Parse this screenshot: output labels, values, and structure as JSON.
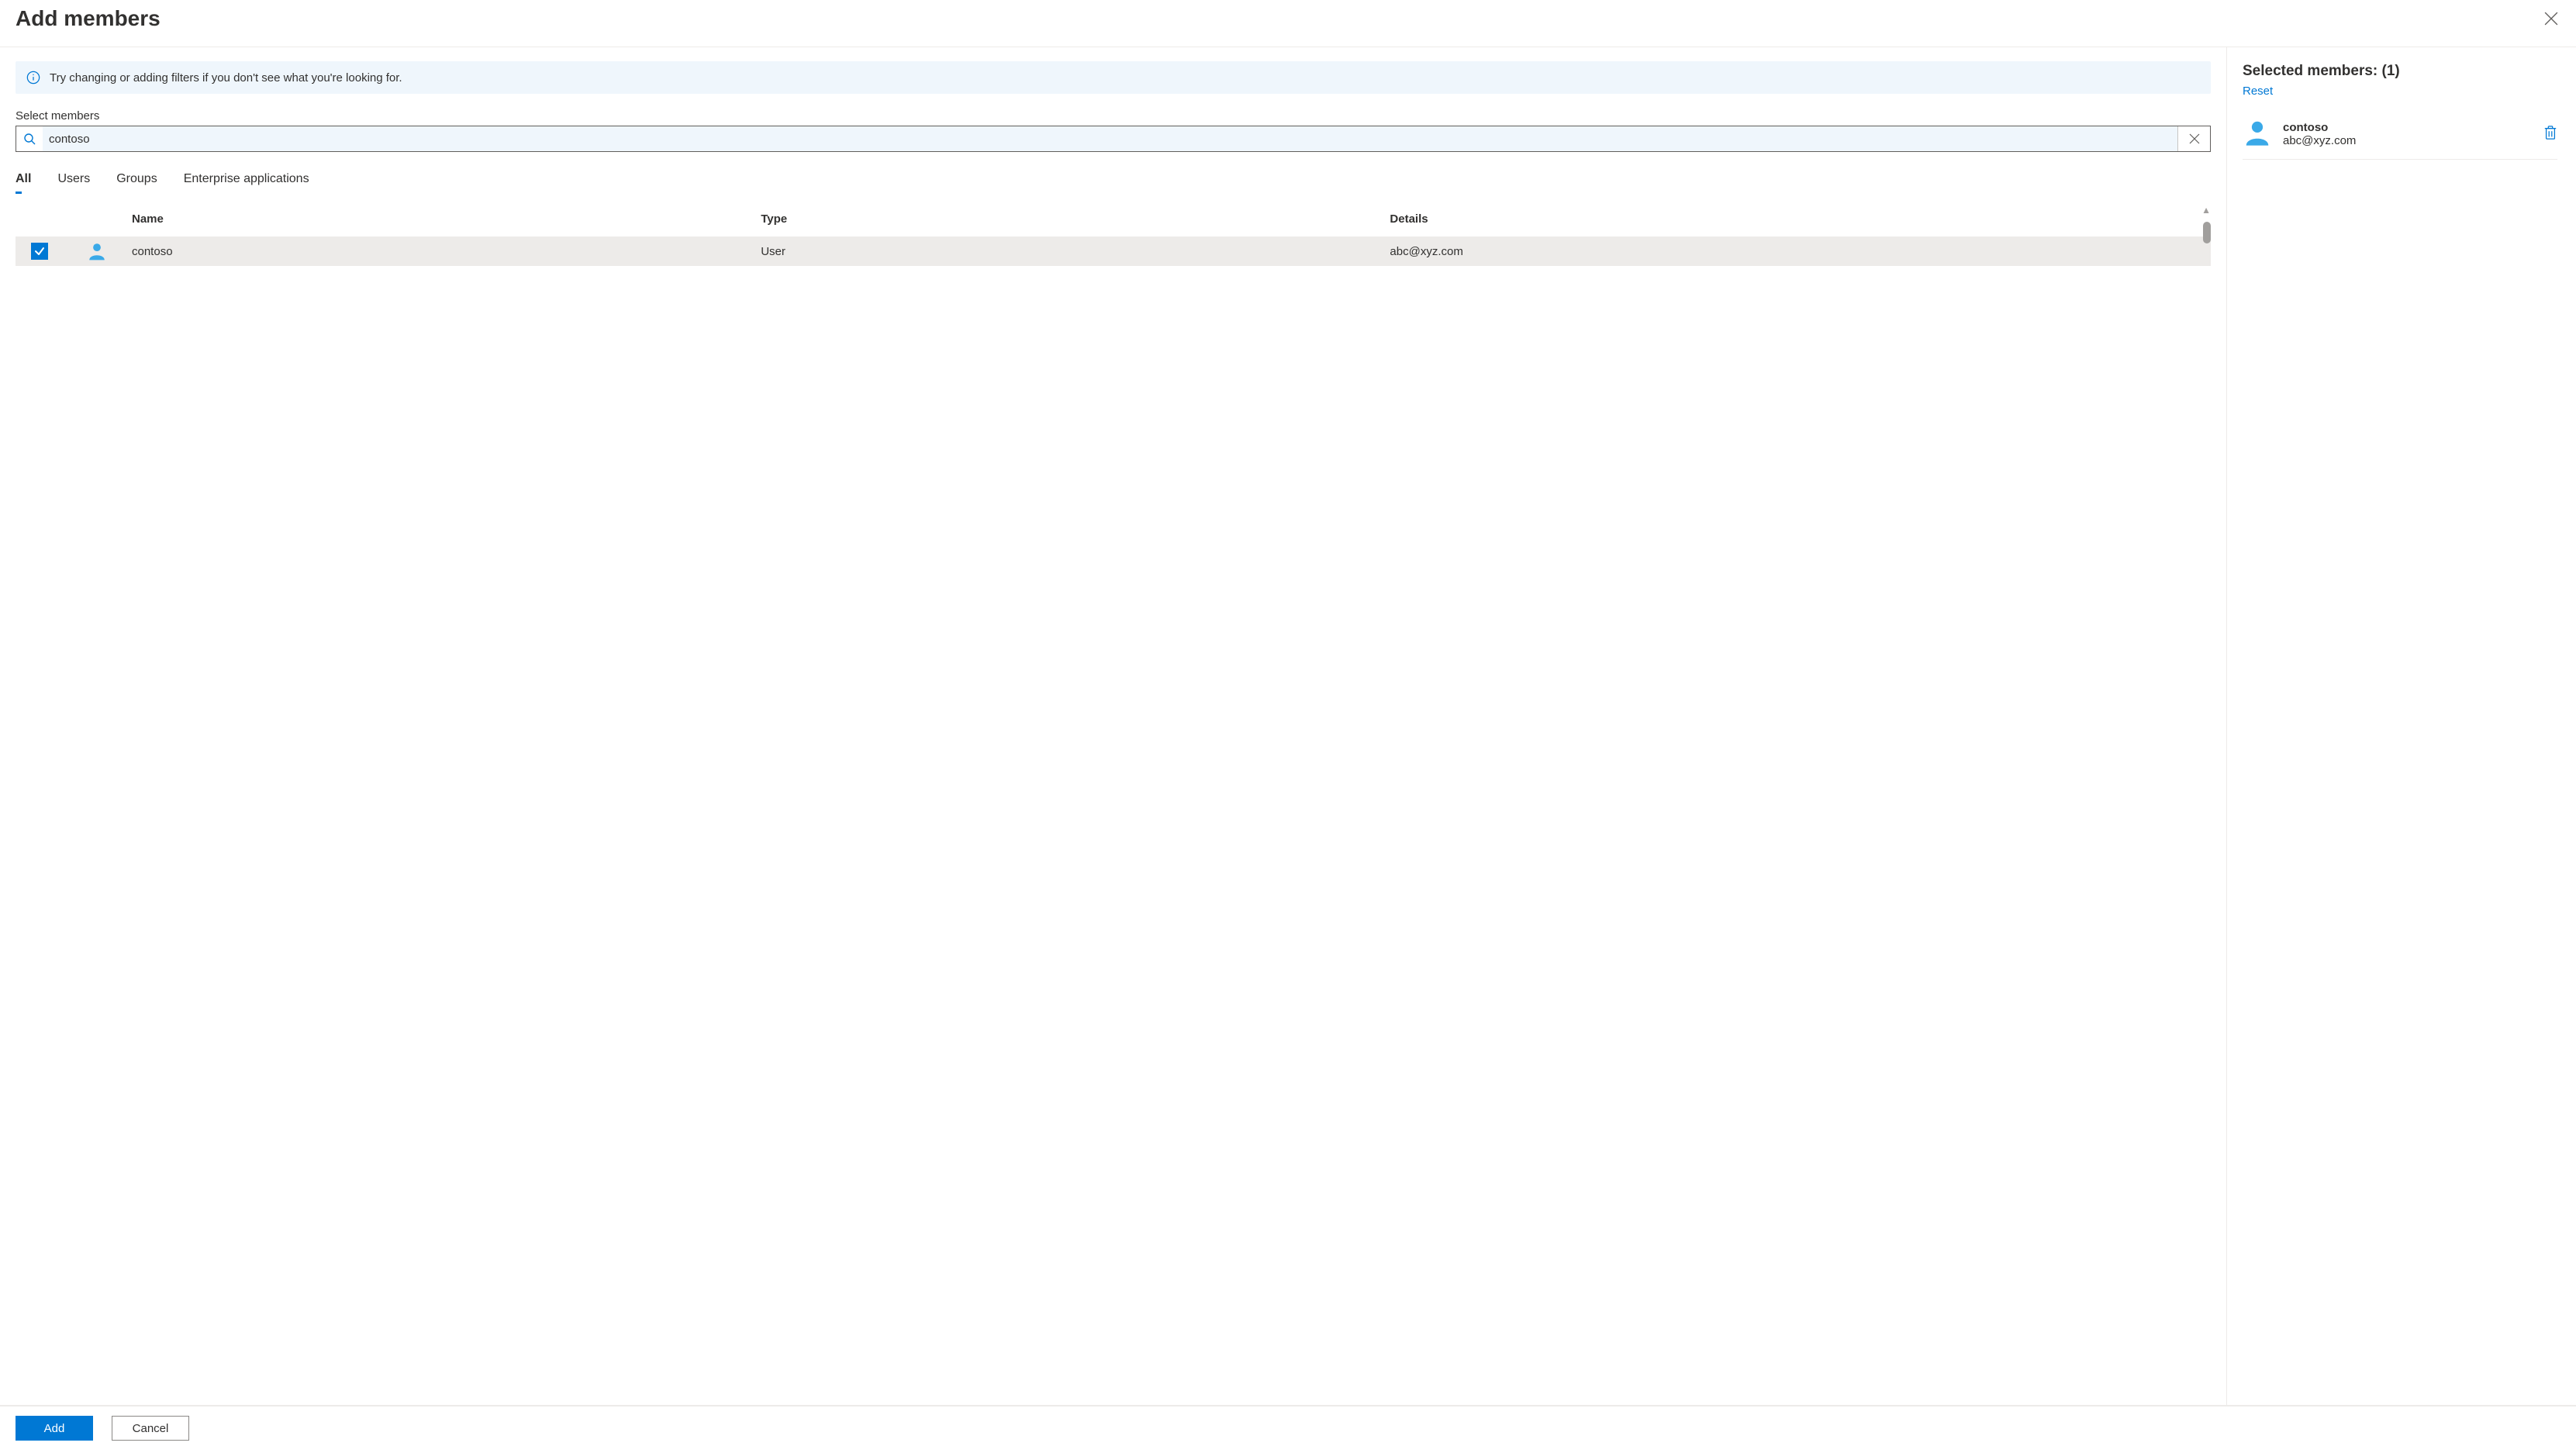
{
  "header": {
    "title": "Add members"
  },
  "info": {
    "message": "Try changing or adding filters if you don't see what you're looking for."
  },
  "search": {
    "label": "Select members",
    "value": "contoso"
  },
  "tabs": {
    "items": [
      {
        "label": "All",
        "active": true
      },
      {
        "label": "Users",
        "active": false
      },
      {
        "label": "Groups",
        "active": false
      },
      {
        "label": "Enterprise applications",
        "active": false
      }
    ]
  },
  "results": {
    "columns": {
      "name": "Name",
      "type": "Type",
      "details": "Details"
    },
    "rows": [
      {
        "checked": true,
        "name": "contoso",
        "type": "User",
        "details": "abc@xyz.com"
      }
    ]
  },
  "selected": {
    "heading_prefix": "Selected members:",
    "count_display": "(1)",
    "reset_label": "Reset",
    "items": [
      {
        "name": "contoso",
        "detail": "abc@xyz.com"
      }
    ]
  },
  "footer": {
    "primary": "Add",
    "secondary": "Cancel"
  }
}
